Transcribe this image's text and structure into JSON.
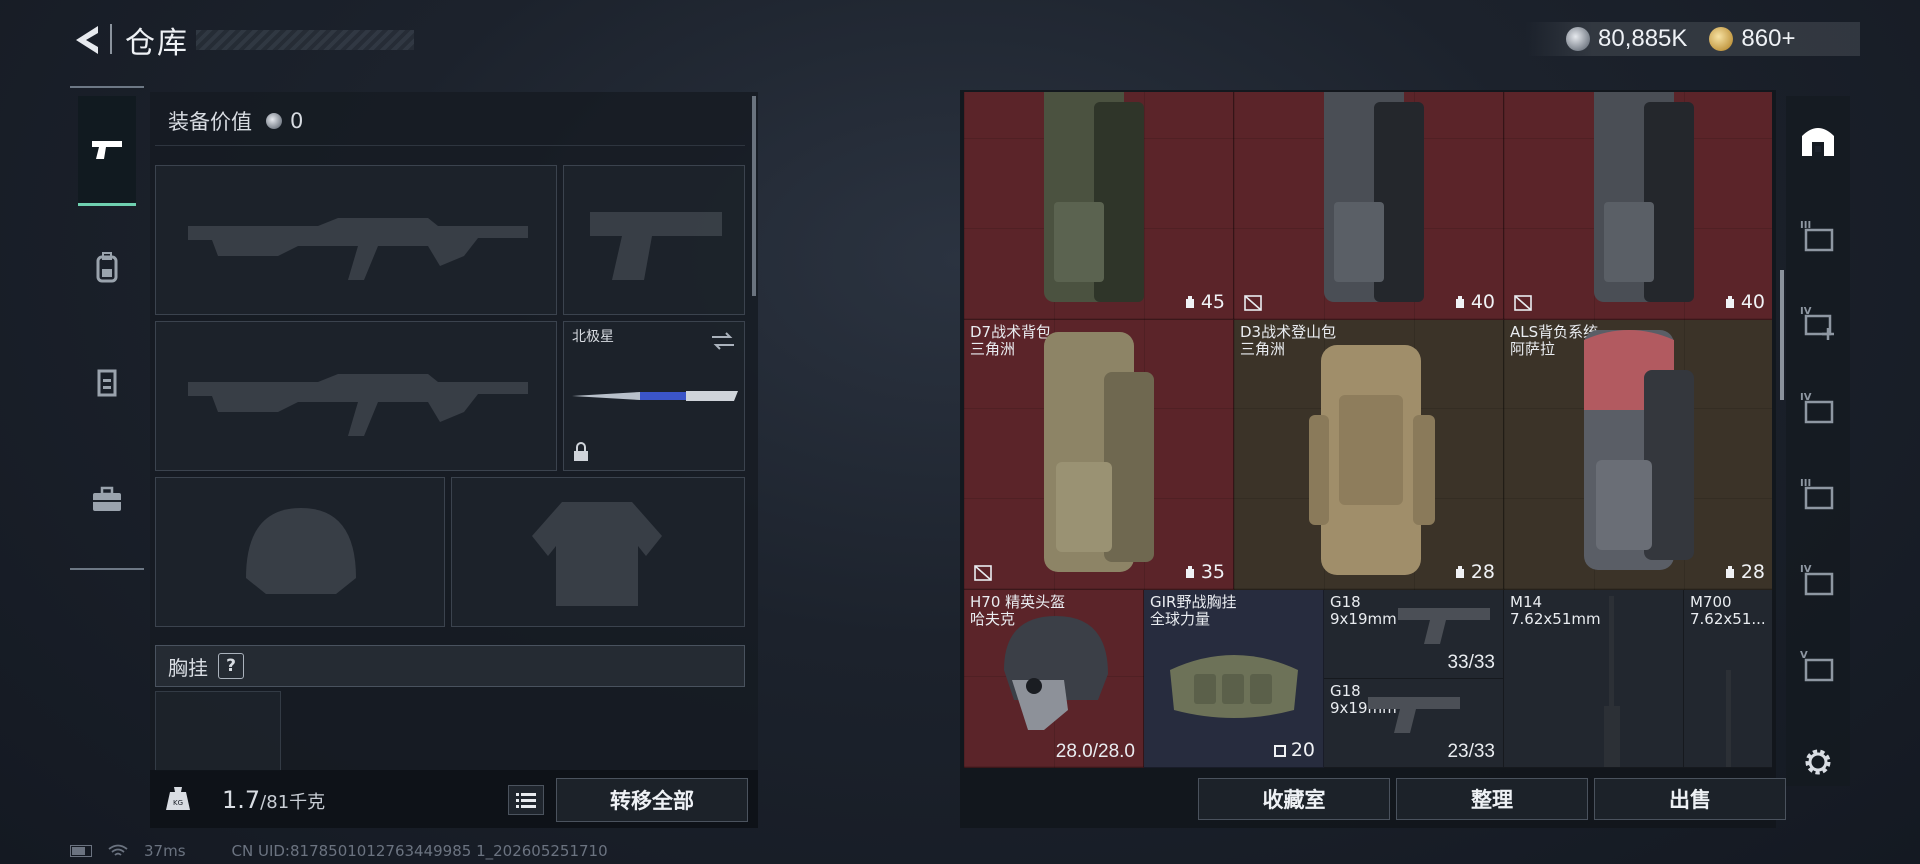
{
  "header": {
    "title": "仓库"
  },
  "currency": [
    {
      "icon": "silver-coin-icon",
      "value": "80,885K"
    },
    {
      "icon": "gold-coin-icon",
      "value": "860+"
    }
  ],
  "left_rail": {
    "tabs": [
      {
        "icon": "pistol-icon",
        "active": true
      },
      {
        "icon": "backpack-icon"
      },
      {
        "icon": "vest-icon"
      },
      {
        "icon": "toolbox-icon"
      }
    ]
  },
  "loadout": {
    "equip_value_label": "装备价值",
    "equip_value": "0",
    "melee": {
      "name": "北极星"
    },
    "chest_label": "胸挂",
    "chest_help": "?"
  },
  "weight": {
    "current": "1.7",
    "max_unit": "/81千克"
  },
  "buttons": {
    "transfer_all": "转移全部",
    "collection": "收藏室",
    "sort": "整理",
    "sell": "出售"
  },
  "status": {
    "ping": "37ms",
    "uid": "CN UID:8178501012763449985 1_202605251710"
  },
  "storage": {
    "top_row": [
      {
        "capacity": "45",
        "no_drop": false
      },
      {
        "capacity": "40",
        "no_drop": true
      },
      {
        "capacity": "40",
        "no_drop": true
      }
    ],
    "packs": [
      {
        "name": "D7战术背包",
        "brand": "三角洲",
        "capacity": "35",
        "no_drop": true
      },
      {
        "name": "D3战术登山包",
        "brand": "三角洲",
        "capacity": "28",
        "no_drop": false
      },
      {
        "name": "ALS背负系统",
        "brand": "阿萨拉",
        "capacity": "28",
        "no_drop": false
      }
    ],
    "items": {
      "helmet": {
        "name": "H70 精英头盔",
        "brand": "哈夫克",
        "durability": "28.0/28.0"
      },
      "rig": {
        "name": "GIR野战胸挂",
        "brand": "全球力量",
        "capacity": "20"
      },
      "g18a": {
        "name": "G18",
        "ammo": "9x19mm",
        "count": "33/33"
      },
      "g18b": {
        "name": "G18",
        "ammo": "9x19mm",
        "count": "23/33"
      },
      "m14": {
        "name": "M14",
        "ammo": "7.62x51mm"
      },
      "m700": {
        "name": "M700",
        "ammo": "7.62x51..."
      }
    }
  },
  "right_rail": [
    {
      "icon": "vault-icon",
      "label": ""
    },
    {
      "icon": "rack-iii-icon",
      "label": "III"
    },
    {
      "icon": "rack-iv-add-icon",
      "label": "IV"
    },
    {
      "icon": "rack-iv-icon",
      "label": "IV"
    },
    {
      "icon": "rack-iii-b-icon",
      "label": "III"
    },
    {
      "icon": "rack-iv-b-icon",
      "label": "IV"
    },
    {
      "icon": "rack-v-icon",
      "label": "V"
    }
  ]
}
